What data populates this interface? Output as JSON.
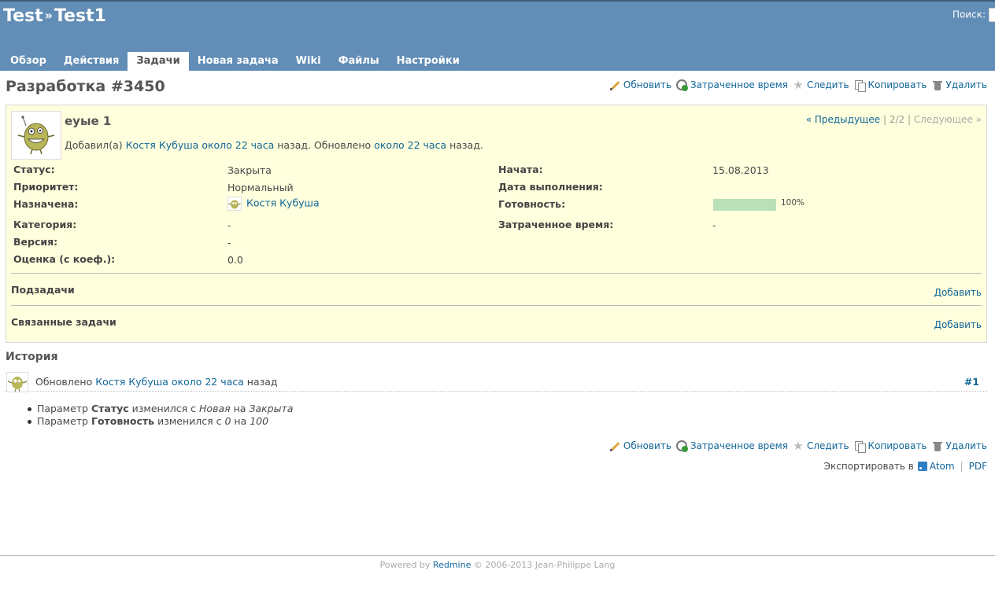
{
  "header": {
    "project": "Test",
    "separator": "»",
    "subproject": "Test1",
    "search_label": "Поиск:"
  },
  "main_menu": [
    "Обзор",
    "Действия",
    "Задачи",
    "Новая задача",
    "Wiki",
    "Файлы",
    "Настройки"
  ],
  "selected_tab": "Задачи",
  "issue": {
    "heading": "Разработка #3450",
    "subject": "еуые 1",
    "added_by_prefix": "Добавил(а)",
    "author": "Костя Кубуша",
    "created_ago": "около 22 часа",
    "updated_mid": "назад. Обновлено",
    "updated_ago": "около 22 часа",
    "updated_suffix": "назад.",
    "nav_prev": "« Предыдущее",
    "nav_sep": "|",
    "nav_pos": "2/2",
    "nav_next": "Следующее »",
    "progress_percent": 100,
    "attributes_left": [
      {
        "label": "Статус:",
        "value": "Закрыта"
      },
      {
        "label": "Приоритет:",
        "value": "Нормальный"
      },
      {
        "label": "Назначена:",
        "value": "Костя Кубуша"
      },
      {
        "label": "Категория:",
        "value": "-"
      },
      {
        "label": "Версия:",
        "value": "-"
      },
      {
        "label": "Оценка (с коеф.):",
        "value": "0.0"
      }
    ],
    "attributes_right": [
      {
        "label": "Начата:",
        "value": "15.08.2013"
      },
      {
        "label": "Дата выполнения:",
        "value": ""
      },
      {
        "label": "Готовность:",
        "value": "100%"
      },
      {
        "label": "Затраченное время:",
        "value": "-"
      }
    ],
    "subtasks_title": "Подзадачи",
    "subtasks_add": "Добавить",
    "relations_title": "Связанные задачи",
    "relations_add": "Добавить"
  },
  "actions": {
    "update": "Обновить",
    "time": "Затраченное время",
    "watch": "Следить",
    "copy": "Копировать",
    "delete": "Удалить"
  },
  "history": {
    "title": "История",
    "updated_label": "Обновлено",
    "author": "Костя Кубуша",
    "ago": "около 22 часа",
    "suffix": "назад",
    "number": "#1",
    "details": [
      {
        "prefix": "Параметр",
        "field": "Статус",
        "changed": "изменился с",
        "old": "Новая",
        "on": "на",
        "new": "Закрыта"
      },
      {
        "prefix": "Параметр",
        "field": "Готовность",
        "changed": "изменился с",
        "old": "0",
        "on": "на",
        "new": "100"
      }
    ]
  },
  "export": {
    "label": "Экспортировать в",
    "atom": "Atom",
    "sep": "|",
    "pdf": "PDF"
  },
  "footer": {
    "powered": "Powered by",
    "redmine": "Redmine",
    "copyright": "© 2006-2013 Jean-Philippe Lang"
  }
}
